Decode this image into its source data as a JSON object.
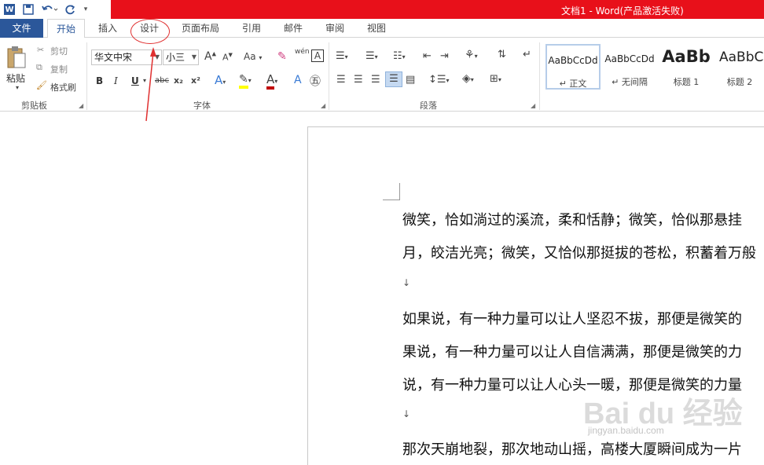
{
  "title_bar": {
    "title": "文档1 - Word(产品激活失败)",
    "word_icon": "W"
  },
  "tabs": [
    {
      "label": "文件"
    },
    {
      "label": "开始"
    },
    {
      "label": "插入"
    },
    {
      "label": "设计"
    },
    {
      "label": "页面布局"
    },
    {
      "label": "引用"
    },
    {
      "label": "邮件"
    },
    {
      "label": "审阅"
    },
    {
      "label": "视图"
    }
  ],
  "clipboard": {
    "paste": "粘贴",
    "cut": "剪切",
    "copy": "复制",
    "format_painter": "格式刷",
    "group_label": "剪贴板"
  },
  "font": {
    "name": "华文中宋",
    "size": "小三",
    "group_label": "字体",
    "bold": "B",
    "italic": "I",
    "underline": "U",
    "strike": "abc",
    "sub": "x₂",
    "sup": "x²",
    "grow": "A",
    "shrink": "A",
    "case": "Aa",
    "color_a": "A",
    "phonetic": "wén",
    "boxed": "A"
  },
  "paragraph": {
    "group_label": "段落"
  },
  "styles": [
    {
      "sample": "AaBbCcDd",
      "name": "↵ 正文"
    },
    {
      "sample": "AaBbCcDd",
      "name": "↵ 无间隔"
    },
    {
      "sample": "AaBb",
      "name": "标题 1"
    },
    {
      "sample": "AaBbC",
      "name": "标题 2"
    }
  ],
  "document": {
    "lines": [
      "微笑，恰如淌过的溪流，柔和恬静；微笑，恰似那悬挂",
      "月，皎洁光亮；微笑，又恰似那挺拔的苍松，积蓄着万般",
      "如果说，有一种力量可以让人坚忍不拔，那便是微笑的",
      "果说，有一种力量可以让人自信满满，那便是微笑的力",
      "说，有一种力量可以让人心头一暖，那便是微笑的力量",
      "那次天崩地裂，那次地动山摇，高楼大厦瞬间成为一片"
    ],
    "paragraph_mark": "↓"
  },
  "watermark": {
    "brand": "Bai du 经验",
    "url": "jingyan.baidu.com"
  },
  "colors": {
    "accent": "#2b579a",
    "titlebar_red": "#e8101a",
    "annotation": "#e03030",
    "highlight": "#ffff00",
    "font_color": "#c00000"
  }
}
